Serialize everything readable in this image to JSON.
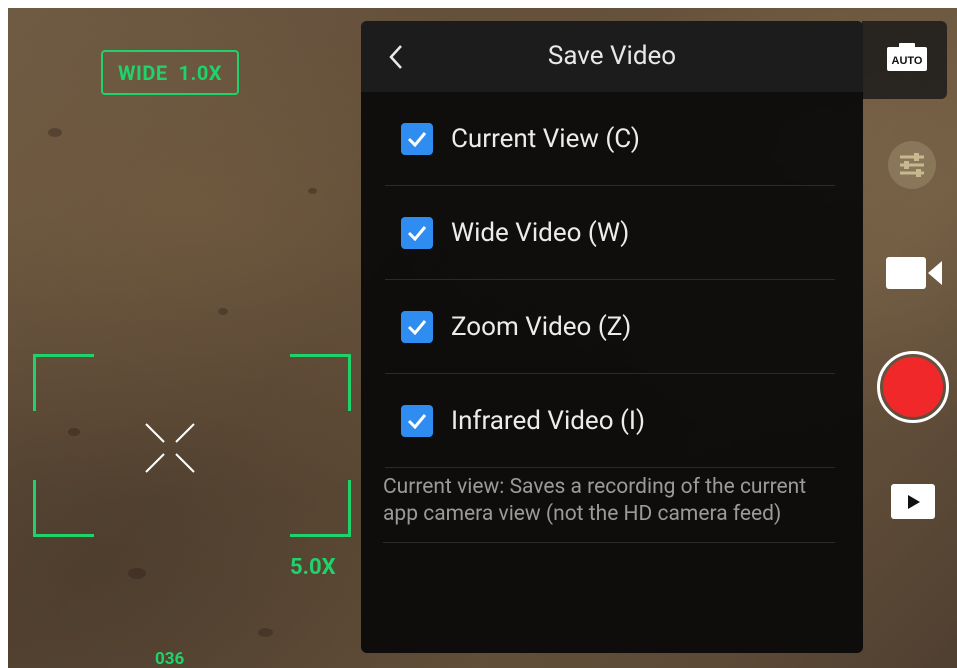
{
  "camera": {
    "lens_badge": "WIDE  1.0X",
    "zoom_level": "5.0X",
    "bottom_readout": "036"
  },
  "rail": {
    "auto_label": "AUTO"
  },
  "panel": {
    "title": "Save Video",
    "options": [
      {
        "label": "Current View (C)",
        "checked": true
      },
      {
        "label": "Wide Video (W)",
        "checked": true
      },
      {
        "label": "Zoom Video (Z)",
        "checked": true
      },
      {
        "label": "Infrared Video (I)",
        "checked": true
      }
    ],
    "help_text": "Current view: Saves a recording of the current app camera view (not the HD camera feed)"
  },
  "colors": {
    "accent_green": "#1fd36b",
    "checkbox_blue": "#2f8cf0",
    "record_red": "#f0282a"
  },
  "icons": [
    "back-chevron-icon",
    "auto-camera-icon",
    "settings-sliders-icon",
    "video-camera-icon",
    "record-icon",
    "playback-icon",
    "checkmark-icon",
    "crosshair-icon"
  ]
}
